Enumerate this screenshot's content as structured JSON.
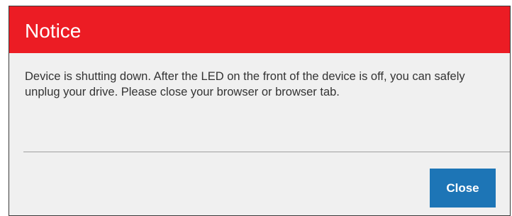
{
  "dialog": {
    "title": "Notice",
    "message": "Device is shutting down. After the LED on the front of the device is off, you can safely unplug your drive. Please close your browser or browser tab.",
    "close_label": "Close"
  },
  "colors": {
    "header_background": "#ec1c24",
    "dialog_background": "#f0f0f0",
    "button_background": "#1d75b6",
    "title_text": "#ffffff",
    "body_text": "#333333"
  }
}
